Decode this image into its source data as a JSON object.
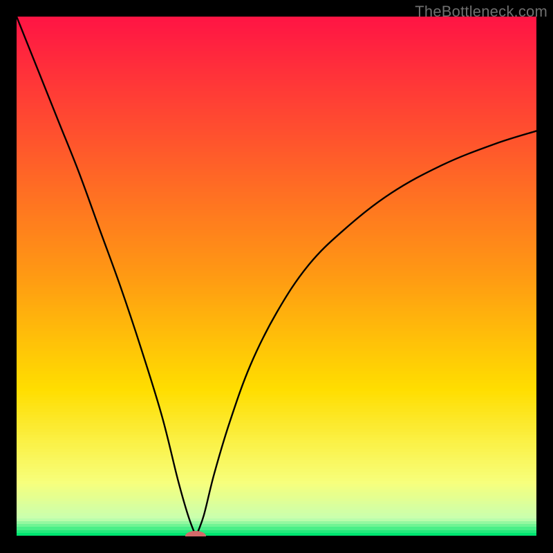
{
  "watermark": {
    "text": "TheBottleneck.com"
  },
  "chart_data": {
    "type": "line",
    "title": "",
    "xlabel": "",
    "ylabel": "",
    "xlim": [
      0,
      100
    ],
    "ylim": [
      0,
      100
    ],
    "grid": false,
    "legend": false,
    "background_gradient": {
      "top_color": "#ff1544",
      "mid_color": "#ffde00",
      "bottom_color": "#00e571",
      "stops": [
        {
          "y_pct": 0.0,
          "color": "#ff1544"
        },
        {
          "y_pct": 50.0,
          "color": "#ff9a13"
        },
        {
          "y_pct": 72.0,
          "color": "#ffde00"
        },
        {
          "y_pct": 90.0,
          "color": "#f7ff7c"
        },
        {
          "y_pct": 97.0,
          "color": "#c8ffb0"
        },
        {
          "y_pct": 100.0,
          "color": "#00e571"
        }
      ]
    },
    "series": [
      {
        "name": "bottleneck-curve",
        "color": "#000000",
        "x": [
          0,
          4,
          8,
          12,
          16,
          20,
          24,
          28,
          31,
          33,
          34.5,
          36,
          38,
          41,
          45,
          50,
          56,
          63,
          72,
          82,
          92,
          100
        ],
        "y": [
          100,
          90,
          80,
          70,
          59,
          48,
          36,
          23,
          11,
          4,
          0,
          4,
          12,
          22,
          33,
          43,
          52,
          59,
          66,
          71.5,
          75.5,
          78
        ]
      }
    ],
    "notch": {
      "x": 34.5,
      "y": 0
    },
    "marker": {
      "name": "optimal-point-marker",
      "shape": "pill",
      "color": "#d46a6a",
      "x_min": 32.5,
      "x_max": 36.5,
      "y": 0,
      "height_rel": 2.0
    }
  },
  "colors": {
    "frame": "#000000",
    "curve": "#000000",
    "marker": "#d46a6a",
    "watermark": "#6f6f6f"
  }
}
